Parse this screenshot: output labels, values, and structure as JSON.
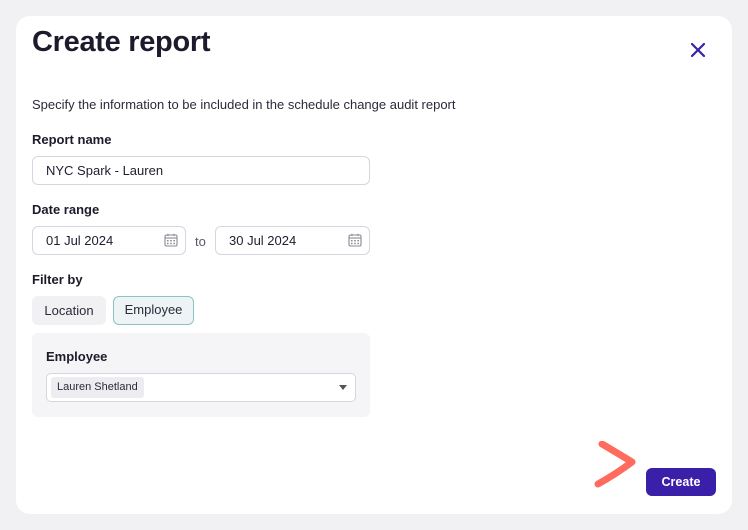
{
  "dialog": {
    "title": "Create report",
    "description": "Specify the information to be included in the schedule change audit report"
  },
  "report_name": {
    "label": "Report name",
    "value": "NYC Spark - Lauren"
  },
  "date_range": {
    "label": "Date range",
    "start": "01 Jul 2024",
    "separator": "to",
    "end": "30 Jul 2024"
  },
  "filter": {
    "label": "Filter by",
    "options": [
      "Location",
      "Employee"
    ],
    "selected": "Employee"
  },
  "employee_panel": {
    "label": "Employee",
    "selected_tag": "Lauren Shetland"
  },
  "actions": {
    "create_label": "Create"
  },
  "colors": {
    "primary_button": "#3a1fa8",
    "close_icon": "#3a1fa8",
    "annotation_arrow": "#ff6b5e",
    "selected_chip_border": "#8cc3c4"
  },
  "icons": {
    "close": "close-icon",
    "calendar": "calendar-icon",
    "dropdown": "chevron-down-icon",
    "annotation": "arrow-pointer-icon"
  }
}
